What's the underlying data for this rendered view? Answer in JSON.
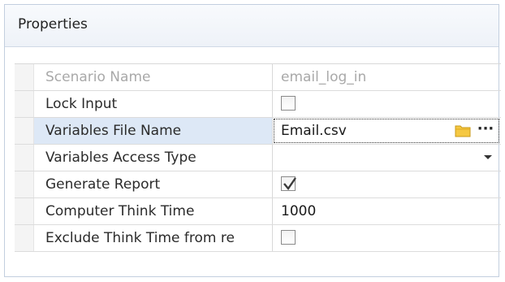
{
  "panel": {
    "title": "Properties"
  },
  "properties": [
    {
      "name": "Scenario Name",
      "value": "email_log_in",
      "disabled": true
    },
    {
      "name": "Lock Input",
      "checked": false
    },
    {
      "name": "Variables File Name",
      "value": "Email.csv",
      "selected": true,
      "icons": [
        "folder-icon",
        "ellipsis-icon"
      ],
      "button_label": "···"
    },
    {
      "name": "Variables Access Type",
      "value": "",
      "dropdown": true
    },
    {
      "name": "Generate Report",
      "checked": true
    },
    {
      "name": "Computer Think Time",
      "value": "1000"
    },
    {
      "name": "Exclude Think Time from re",
      "checked": false
    }
  ],
  "colors": {
    "selection": "#dde8f6",
    "border": "#c3cfdf",
    "folder": "#f5c842"
  }
}
